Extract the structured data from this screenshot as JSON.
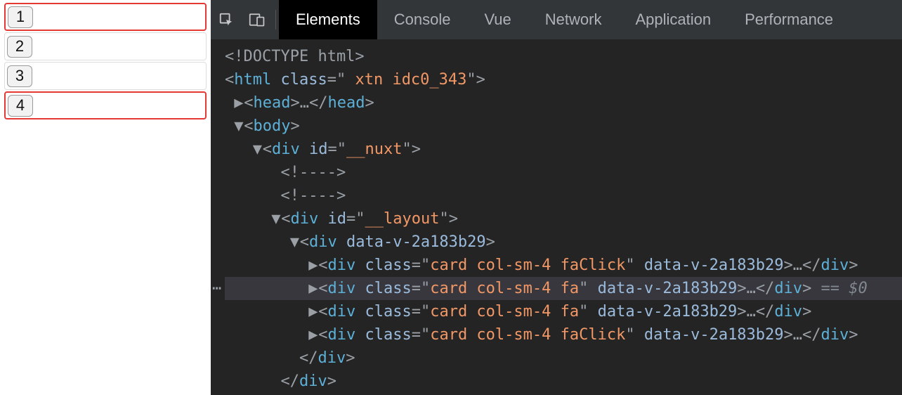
{
  "page": {
    "cards": [
      {
        "label": "1",
        "highlight": true
      },
      {
        "label": "2",
        "highlight": false
      },
      {
        "label": "3",
        "highlight": false
      },
      {
        "label": "4",
        "highlight": true
      }
    ]
  },
  "devtools": {
    "tabs": [
      "Elements",
      "Console",
      "Vue",
      "Network",
      "Application",
      "Performance"
    ],
    "active_tab": "Elements",
    "dom": {
      "doctype": "<!DOCTYPE html>",
      "html_open_prefix": "<html ",
      "html_class_attr": "class",
      "html_class_val": " xtn idc0_343",
      "html_close_angle": ">",
      "head_open": "<head>",
      "head_ellipsis": "…",
      "head_close": "</head>",
      "body_open": "<body>",
      "nuxt_div": {
        "tag": "<div ",
        "attr": "id",
        "val": "__nuxt",
        "close": ">"
      },
      "comment1": "<!---->",
      "comment2": "<!---->",
      "layout_div": {
        "tag": "<div ",
        "attr": "id",
        "val": "__layout",
        "close": ">"
      },
      "wrapper_div": {
        "tag": "<div ",
        "attr": "data-v-2a183b29",
        "close": ">"
      },
      "card_divs": [
        {
          "class_val": "card col-sm-4 faClick",
          "data_attr": "data-v-2a183b29",
          "selected": false
        },
        {
          "class_val": "card col-sm-4 fa",
          "data_attr": "data-v-2a183b29",
          "selected": true
        },
        {
          "class_val": "card col-sm-4 fa",
          "data_attr": "data-v-2a183b29",
          "selected": false
        },
        {
          "class_val": "card col-sm-4 faClick",
          "data_attr": "data-v-2a183b29",
          "selected": false
        }
      ],
      "div_close": "</div>",
      "selected_suffix": " == $0"
    },
    "tokens": {
      "div_open": "<div ",
      "class_attr": "class",
      "eq_quote": "=\"",
      "end_quote": "\"",
      "angle_close": ">",
      "ellipsis": "…",
      "div_close_tag": "</div>"
    }
  }
}
